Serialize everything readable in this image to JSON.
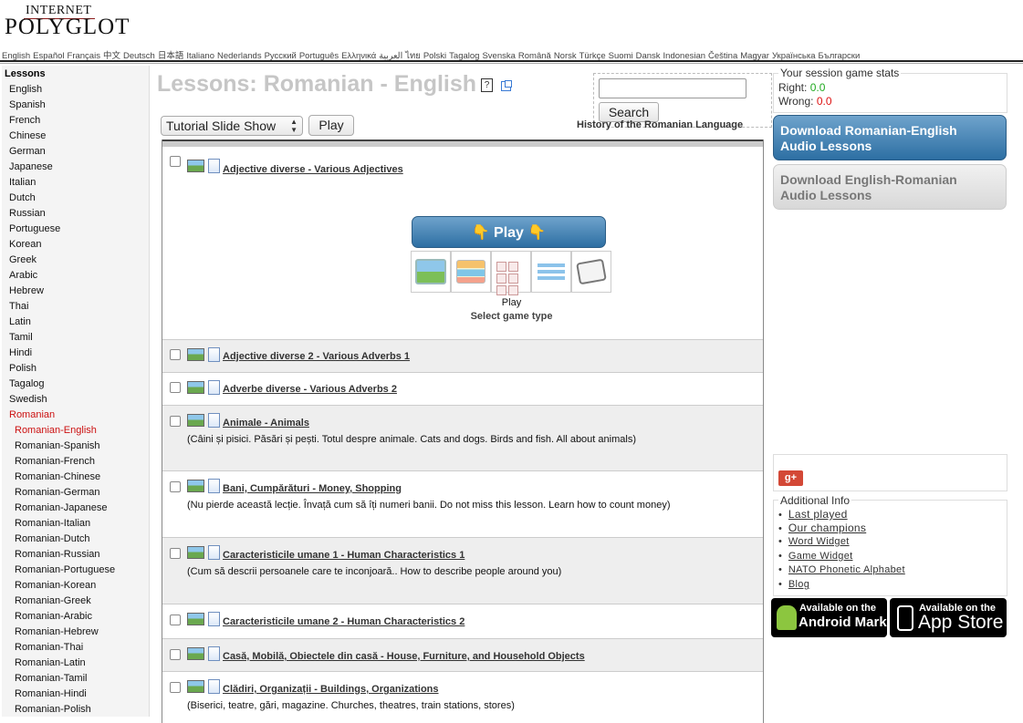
{
  "logo": {
    "line1": "INTERNET",
    "line2": "POLYGLOT"
  },
  "languages": [
    "English",
    "Español",
    "Français",
    "中文",
    "Deutsch",
    "日本語",
    "Italiano",
    "Nederlands",
    "Русский",
    "Português",
    "Ελληνικά",
    "العربية",
    "ไทย",
    "Polski",
    "Tagalog",
    "Svenska",
    "Română",
    "Norsk",
    "Türkçe",
    "Suomi",
    "Dansk",
    "Indonesian",
    "Čeština",
    "Magyar",
    "Українська",
    "Български"
  ],
  "sidebar": {
    "heading": "Lessons",
    "items": [
      "English",
      "Spanish",
      "French",
      "Chinese",
      "German",
      "Japanese",
      "Italian",
      "Dutch",
      "Russian",
      "Portuguese",
      "Korean",
      "Greek",
      "Arabic",
      "Hebrew",
      "Thai",
      "Latin",
      "Tamil",
      "Hindi",
      "Polish",
      "Tagalog",
      "Swedish",
      "Romanian"
    ],
    "active_item": "Romanian",
    "subitems": [
      "Romanian-English",
      "Romanian-Spanish",
      "Romanian-French",
      "Romanian-Chinese",
      "Romanian-German",
      "Romanian-Japanese",
      "Romanian-Italian",
      "Romanian-Dutch",
      "Romanian-Russian",
      "Romanian-Portuguese",
      "Romanian-Korean",
      "Romanian-Greek",
      "Romanian-Arabic",
      "Romanian-Hebrew",
      "Romanian-Thai",
      "Romanian-Latin",
      "Romanian-Tamil",
      "Romanian-Hindi",
      "Romanian-Polish"
    ],
    "active_subitem": "Romanian-English"
  },
  "main": {
    "title": "Lessons: Romanian - English",
    "help_glyph": "?",
    "game_select": "Tutorial Slide Show",
    "play_label": "Play",
    "history_link": "History of the Romanian Language"
  },
  "search": {
    "placeholder": "",
    "button": "Search"
  },
  "expanded": {
    "play_button": "👇 Play 👇",
    "play_label": "Play",
    "select_label": "Select game type",
    "game_types": [
      "flashcards",
      "matching",
      "word-tiles",
      "list",
      "dice"
    ]
  },
  "lessons": [
    {
      "title": "Adjective diverse - Various Adjectives",
      "desc": ""
    },
    {
      "title": "Adjective diverse 2 - Various Adverbs 1",
      "desc": ""
    },
    {
      "title": "Adverbe diverse - Various Adverbs 2",
      "desc": ""
    },
    {
      "title": "Animale - Animals",
      "desc": "(Câini și pisici. Păsări și pești. Totul despre animale. Cats and dogs. Birds and fish. All about animals)"
    },
    {
      "title": "Bani, Cumpărături - Money, Shopping",
      "desc": "(Nu pierde această lecție. Învață cum să îți numeri banii. Do not miss this lesson. Learn how to count money)"
    },
    {
      "title": "Caracteristicile umane 1 - Human Characteristics 1",
      "desc": "(Cum să descrii persoanele care te inconjoară.. How to describe people around you)"
    },
    {
      "title": "Caracteristicile umane 2 - Human Characteristics 2",
      "desc": ""
    },
    {
      "title": "Casă, Mobilă, Obiectele din casă - House, Furniture, and Household Objects",
      "desc": ""
    },
    {
      "title": "Clădiri, Organizații - Buildings, Organizations",
      "desc": "(Biserici, teatre, gări, magazine. Churches, theatres, train stations, stores)"
    }
  ],
  "stats": {
    "legend": "Your session game stats",
    "right_label": "Right:",
    "right_value": "0.0",
    "wrong_label": "Wrong:",
    "wrong_value": "0.0"
  },
  "downloads": {
    "primary": [
      "Download Romanian-English",
      "Audio Lessons"
    ],
    "secondary": [
      "Download English-Romanian",
      "Audio Lessons"
    ]
  },
  "gplus": "g+",
  "additional": {
    "legend": "Additional Info",
    "links": [
      "Last played",
      "Our champions",
      "Word Widget",
      "Game Widget",
      "NATO Phonetic Alphabet",
      "Blog"
    ]
  },
  "badges": {
    "android": {
      "line1": "Available on the",
      "line2": "Android Market"
    },
    "apple": {
      "line1": "Available on the",
      "line2": "App Store"
    }
  },
  "colors": {
    "accent_blue": "#2d6fa3",
    "active_red": "#cc1111",
    "right_green": "#22aa22",
    "wrong_red": "#dd1111"
  }
}
